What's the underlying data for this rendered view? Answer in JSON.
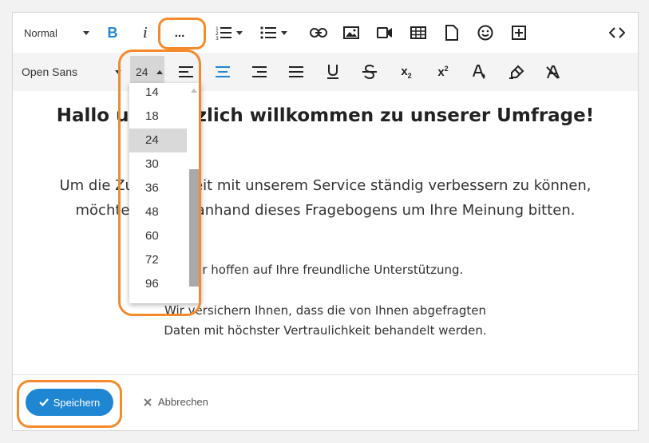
{
  "toolbar1": {
    "paragraph_style": "Normal",
    "more_label": "..."
  },
  "toolbar2": {
    "font_family": "Open Sans",
    "font_size": "24"
  },
  "font_size_dropdown": {
    "options": [
      "14",
      "18",
      "24",
      "30",
      "36",
      "48",
      "60",
      "72",
      "96"
    ],
    "selected": "24"
  },
  "content": {
    "heading": "Hallo und herzlich willkommen zu unserer Umfrage!",
    "para1_line1": "Um die Zufriedenheit mit unserem Service ständig verbessern zu können,",
    "para1_line2": "möchten wir Sie anhand dieses Fragebogens um Ihre Meinung bitten.",
    "para2": "Wir hoffen auf Ihre freundliche Unterstützung.",
    "para3_line1": "Wir versichern Ihnen, dass die von Ihnen abgefragten",
    "para3_line2": "Daten mit höchster Vertraulichkeit behandelt werden."
  },
  "footer": {
    "save_label": "Speichern",
    "cancel_label": "Abbrechen"
  },
  "colors": {
    "accent": "#1f86d3",
    "highlight": "#f58a2b"
  }
}
